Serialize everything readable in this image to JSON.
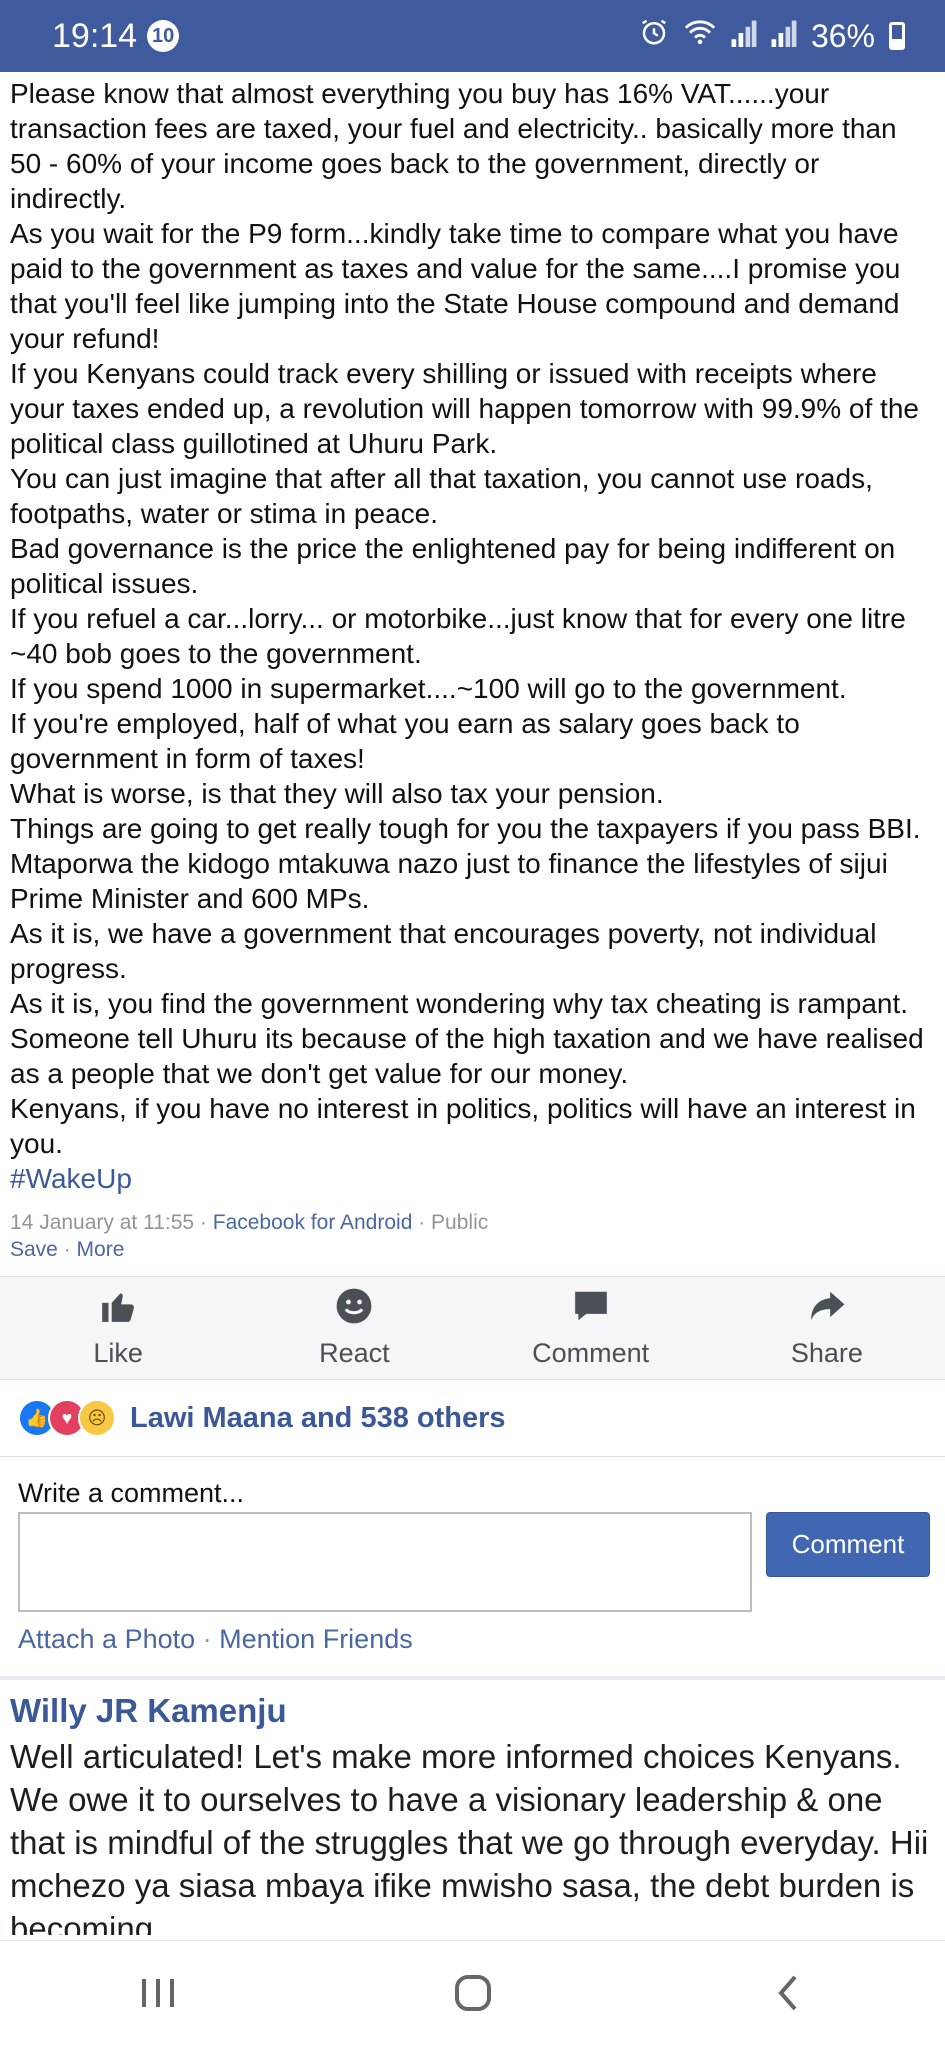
{
  "status_bar": {
    "time": "19:14",
    "notification_count": "10",
    "battery": "36%"
  },
  "post": {
    "paragraphs": [
      "Please know that almost everything you buy has 16% VAT......your transaction fees are taxed, your fuel and electricity.. basically more than 50 - 60% of your income goes back to the government, directly or indirectly.",
      "As you wait for the P9 form...kindly take time to compare what you have paid to the government as taxes and value for the same....I promise you that you'll feel like jumping into the State House compound and demand your refund!",
      "If you Kenyans could track every shilling or issued with receipts where your taxes ended up, a revolution will happen tomorrow with 99.9% of the political class guillotined at Uhuru Park.",
      "You can just imagine that after all that taxation, you cannot use roads, footpaths, water or stima in peace.",
      "Bad governance is the price the enlightened pay for being indifferent on political issues.",
      "If you refuel a car...lorry... or motorbike...just know that for every one litre ~40 bob goes to the government.",
      "If you spend 1000 in supermarket....~100 will go to the government.",
      "If you're employed, half of what you earn as salary goes back to government in form of taxes!",
      "What is worse, is that they will also tax your pension.",
      "Things are going to get really tough for you the taxpayers if you pass BBI. Mtaporwa the kidogo mtakuwa nazo just to finance the lifestyles of sijui Prime Minister and 600 MPs.",
      "As it is, we have a government that encourages poverty, not individual progress.",
      "As it is, you find the government wondering why tax cheating is rampant. Someone tell Uhuru its because of the high taxation and we have realised as a people that we don't get value for our money.",
      "Kenyans, if you have no interest in politics, politics will have an interest in you."
    ],
    "hashtag": "#WakeUp",
    "date": "14 January at 11:55",
    "source": "Facebook for Android",
    "privacy": "Public",
    "save_label": "Save",
    "more_label": "More"
  },
  "actions": {
    "like": "Like",
    "react": "React",
    "comment": "Comment",
    "share": "Share"
  },
  "reactions": {
    "summary": "Lawi Maana and 538 others"
  },
  "composer": {
    "label": "Write a comment...",
    "button": "Comment",
    "attach_photo": "Attach a Photo",
    "mention_friends": "Mention Friends"
  },
  "comment": {
    "author": "Willy JR Kamenju",
    "text": "Well articulated! Let's make more informed choices Kenyans. We owe it to ourselves to have a visionary leadership & one that is mindful of the struggles that we go through everyday. Hii mchezo ya siasa mbaya ifike mwisho sasa, the debt burden is becoming"
  },
  "colors": {
    "status_bar": "#3f5b9d",
    "link": "#3b5998",
    "button": "#4267b2"
  }
}
